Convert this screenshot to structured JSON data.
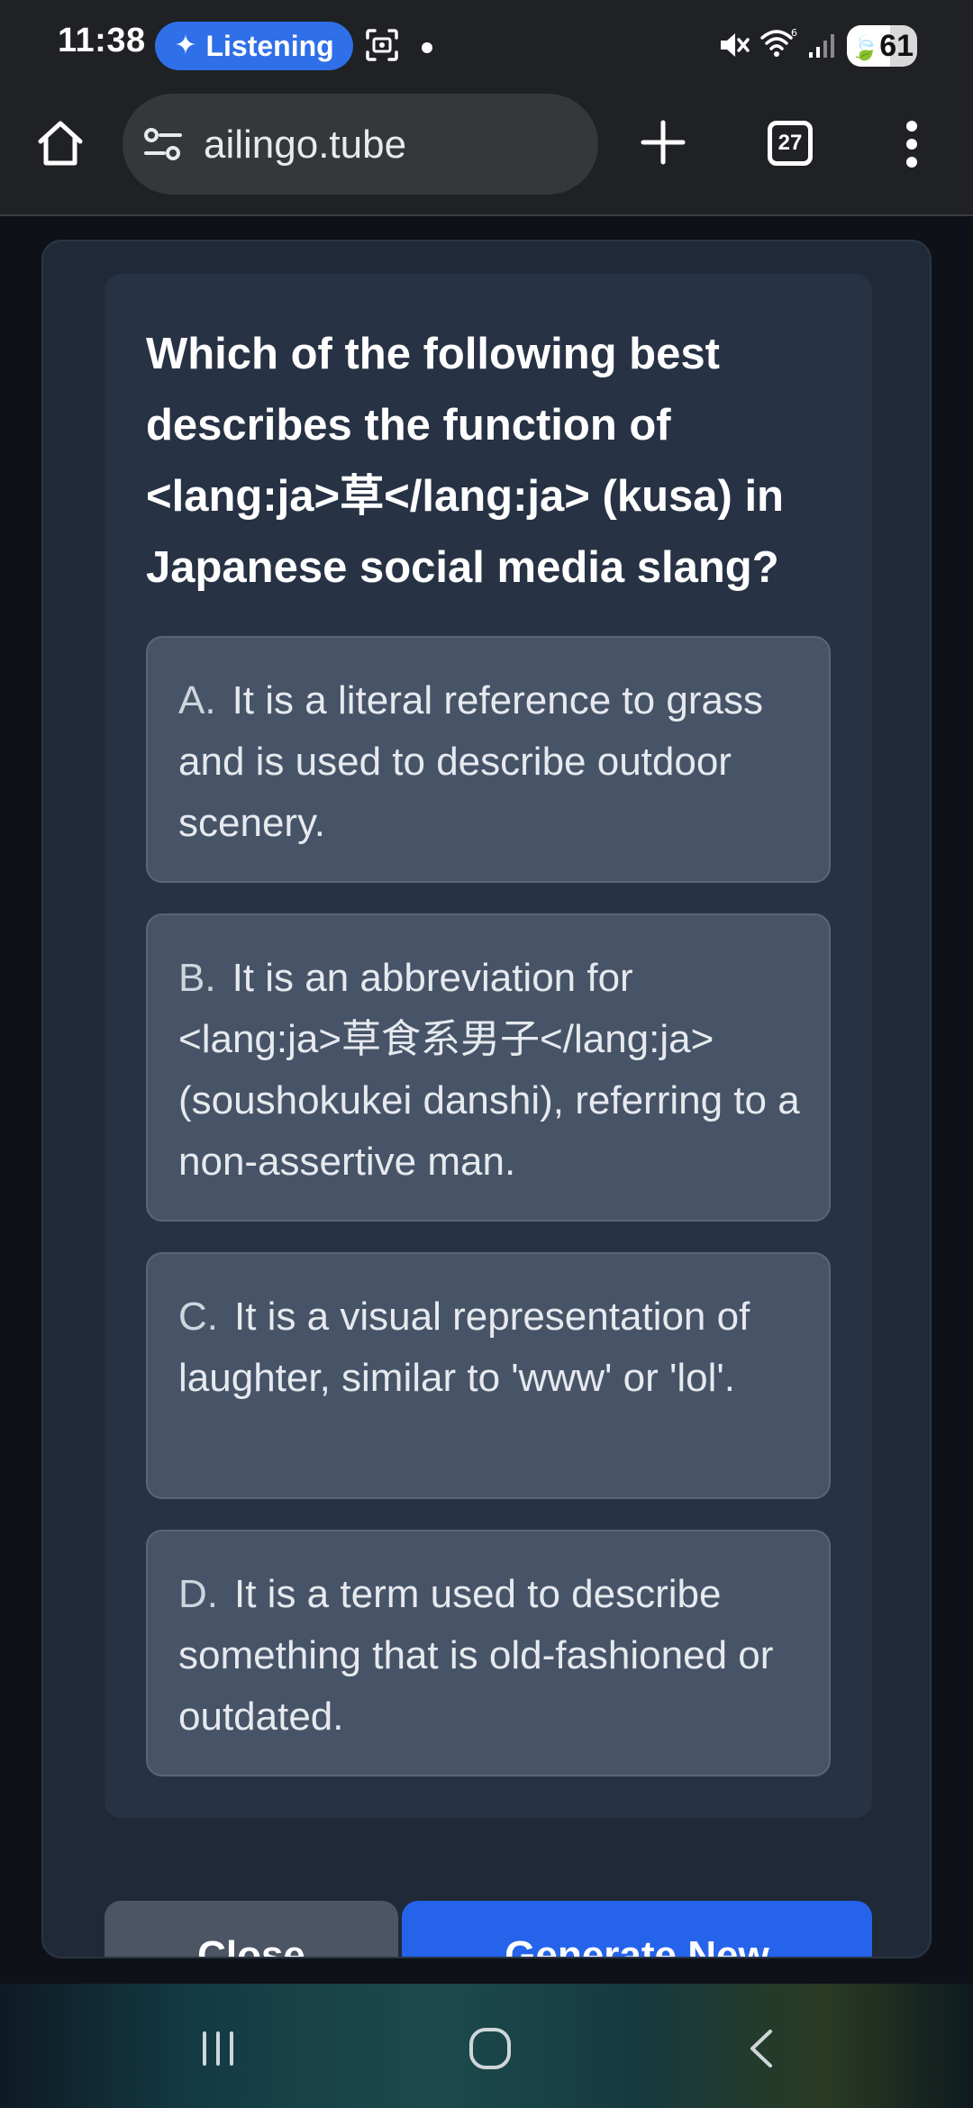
{
  "status_bar": {
    "time": "11:38",
    "listening_label": "Listening",
    "battery_level": "61",
    "battery_fraction": 0.61
  },
  "browser": {
    "url": "ailingo.tube",
    "tab_count": "27"
  },
  "quiz": {
    "question": "Which of the following best describes the function of <lang:ja>草</lang:ja> (kusa) in Japanese social media slang?",
    "options": [
      {
        "letter": "A.",
        "text": "It is a literal reference to grass and is used to describe outdoor scenery."
      },
      {
        "letter": "B.",
        "text": "It is an abbreviation for <lang:ja>草食系男子</lang:ja> (soushokukei danshi), referring to a non-assertive man."
      },
      {
        "letter": "C.",
        "text": "It is a visual representation of laughter, similar to 'www' or 'lol'."
      },
      {
        "letter": "D.",
        "text": "It is a term used to describe something that is old-fashioned or outdated."
      }
    ]
  },
  "actions": {
    "close_label": "Close",
    "generate_label": "Generate New"
  },
  "icons": {
    "home": "home-icon",
    "site_settings": "tune-icon",
    "new_tab": "plus-icon",
    "tabs": "tab-switcher-icon",
    "menu": "more-vert-icon",
    "mute": "mute-icon",
    "wifi": "wifi-icon",
    "signal": "signal-icon",
    "screenshot": "screenshot-icon"
  },
  "colors": {
    "accent": "#2563eb",
    "listening_pill": "#2f6fe8",
    "option_bg": "#475467",
    "card_bg": "#273244"
  }
}
